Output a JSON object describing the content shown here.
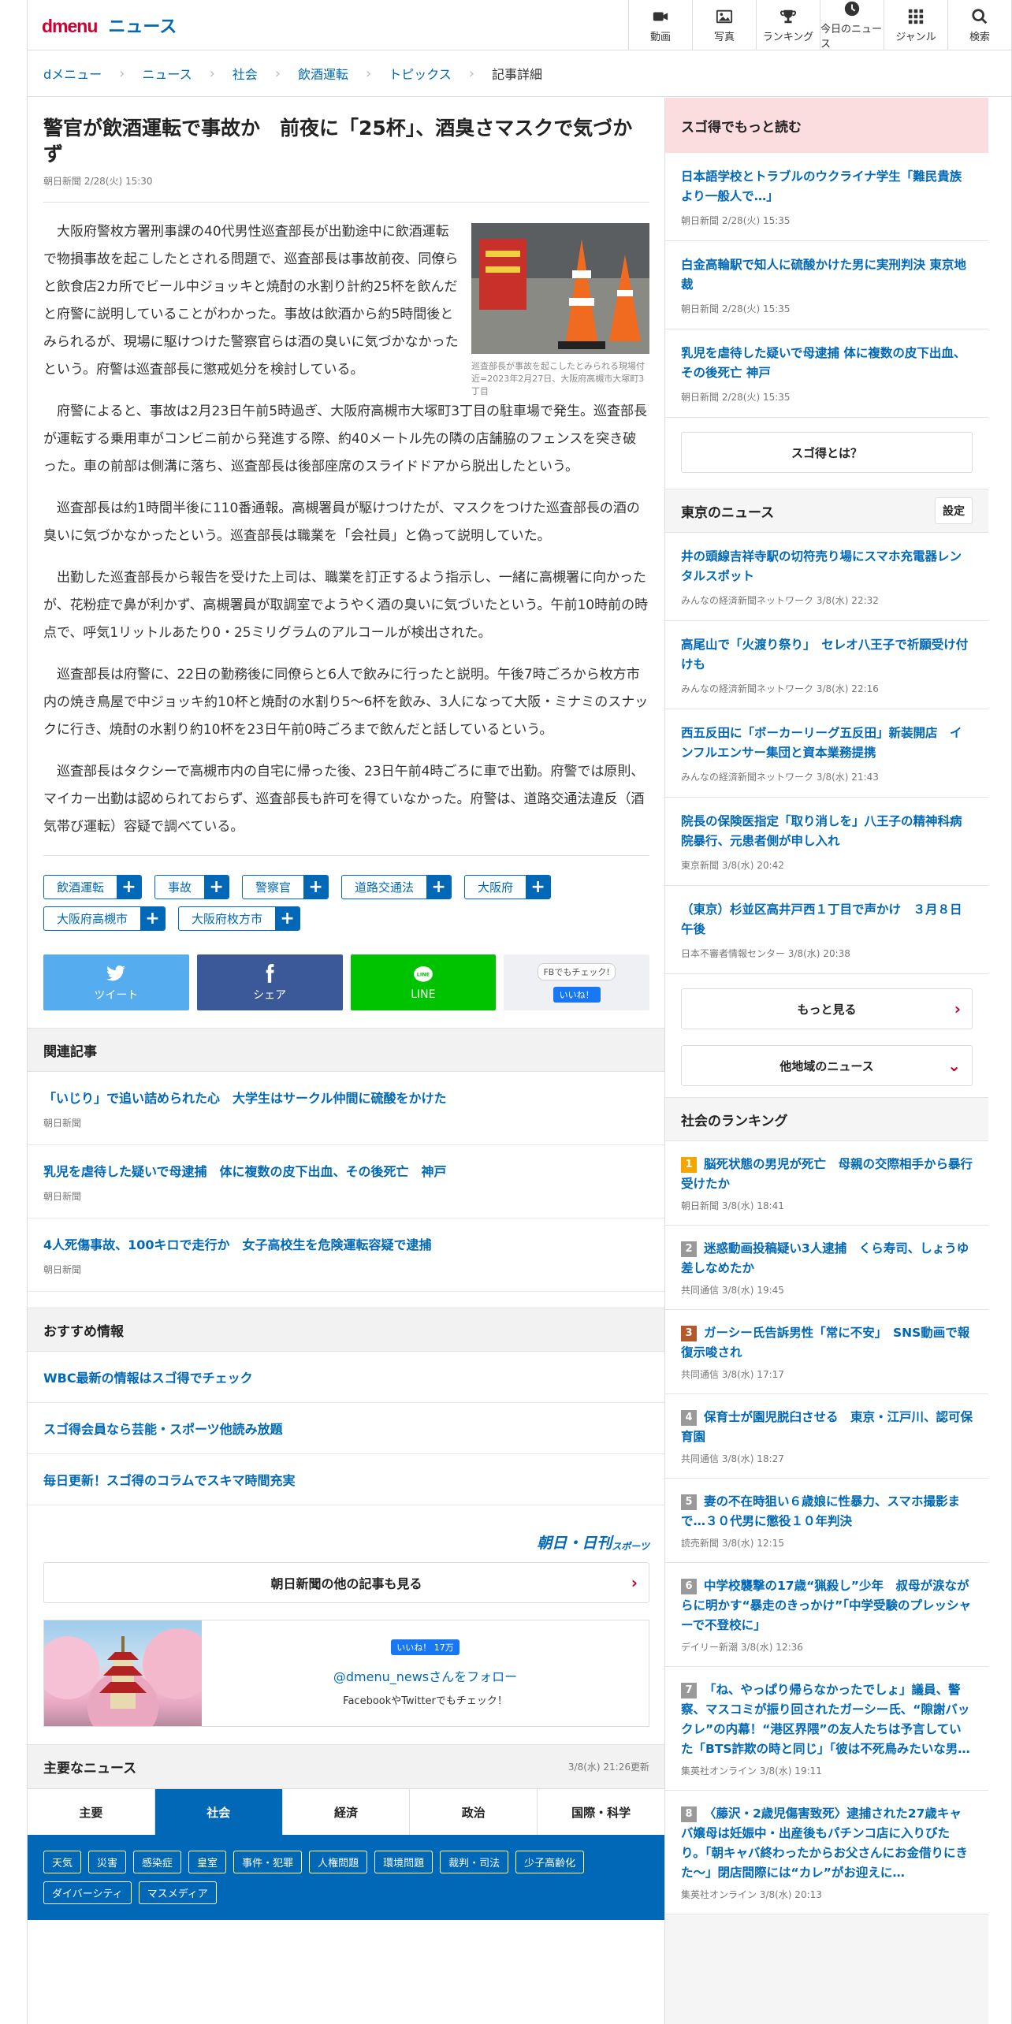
{
  "header": {
    "logo_d": "dmenu",
    "logo_news": "ニュース",
    "nav": [
      {
        "label": "動画",
        "icon": "video-icon"
      },
      {
        "label": "写真",
        "icon": "photo-icon"
      },
      {
        "label": "ランキング",
        "icon": "trophy-icon"
      },
      {
        "label": "今日のニュース",
        "icon": "clock-icon"
      },
      {
        "label": "ジャンル",
        "icon": "grid-icon"
      },
      {
        "label": "検索",
        "icon": "search-icon"
      }
    ]
  },
  "breadcrumb": [
    "dメニュー",
    "ニュース",
    "社会",
    "飲酒運転",
    "トピックス",
    "記事詳細"
  ],
  "article": {
    "title": "警官が飲酒運転で事故か　前夜に「25杯」、酒臭さマスクで気づかず",
    "meta": "朝日新聞 2/28(火) 15:30",
    "image_caption": "巡査部長が事故を起こしたとみられる現場付近=2023年2月27日、大阪府高槻市大塚町3丁目",
    "paragraphs": [
      "大阪府警枚方署刑事課の40代男性巡査部長が出勤途中に飲酒運転で物損事故を起こしたとされる問題で、巡査部長は事故前夜、同僚らと飲食店2カ所でビール中ジョッキと焼酎の水割り計約25杯を飲んだと府警に説明していることがわかった。事故は飲酒から約5時間後とみられるが、現場に駆けつけた警察官らは酒の臭いに気づかなかったという。府警は巡査部長に懲戒処分を検討している。",
      "府警によると、事故は2月23日午前5時過ぎ、大阪府高槻市大塚町3丁目の駐車場で発生。巡査部長が運転する乗用車がコンビニ前から発進する際、約40メートル先の隣の店舗脇のフェンスを突き破った。車の前部は側溝に落ち、巡査部長は後部座席のスライドドアから脱出したという。",
      "巡査部長は約1時間半後に110番通報。高槻署員が駆けつけたが、マスクをつけた巡査部長の酒の臭いに気づかなかったという。巡査部長は職業を「会社員」と偽って説明していた。",
      "出勤した巡査部長から報告を受けた上司は、職業を訂正するよう指示し、一緒に高槻署に向かったが、花粉症で鼻が利かず、高槻署員が取調室でようやく酒の臭いに気づいたという。午前10時前の時点で、呼気1リットルあたり0・25ミリグラムのアルコールが検出された。",
      "巡査部長は府警に、22日の勤務後に同僚らと6人で飲みに行ったと説明。午後7時ごろから枚方市内の焼き鳥屋で中ジョッキ約10杯と焼酎の水割り5〜6杯を飲み、3人になって大阪・ミナミのスナックに行き、焼酎の水割り約10杯を23日午前0時ごろまで飲んだと話しているという。",
      "巡査部長はタクシーで高槻市内の自宅に帰った後、23日午前4時ごろに車で出勤。府警では原則、マイカー出勤は認められておらず、巡査部長も許可を得ていなかった。府警は、道路交通法違反（酒気帯び運転）容疑で調べている。"
    ],
    "tags": [
      "飲酒運転",
      "事故",
      "警察官",
      "道路交通法",
      "大阪府",
      "大阪府高槻市",
      "大阪府枚方市"
    ],
    "share": {
      "tweet": "ツイート",
      "share": "シェア",
      "line": "LINE",
      "fb_check": "FBでもチェック!",
      "like": "いいね！"
    }
  },
  "related": {
    "heading": "関連記事",
    "items": [
      {
        "title": "「いじり」で追い詰められた心　大学生はサークル仲間に硫酸をかけた",
        "source": "朝日新聞"
      },
      {
        "title": "乳児を虐待した疑いで母逮捕　体に複数の皮下出血、その後死亡　神戸",
        "source": "朝日新聞"
      },
      {
        "title": "4人死傷事故、100キロで走行か　女子高校生を危険運転容疑で逮捕",
        "source": "朝日新聞"
      }
    ]
  },
  "recommend": {
    "heading": "おすすめ情報",
    "items": [
      "WBC最新の情報はスゴ得でチェック",
      "スゴ得会員なら芸能・スポーツ他読み放題",
      "毎日更新！スゴ得のコラムでスキマ時間充実"
    ]
  },
  "brand": {
    "main": "朝日・日刊",
    "sub": "スポーツ"
  },
  "more_from": "朝日新聞の他の記事も見る",
  "follow_box": {
    "like": "いいね！ 17万",
    "follow": "@dmenu_newsさんをフォロー",
    "sub": "FacebookやTwitterでもチェック！"
  },
  "main_news": {
    "heading": "主要なニュース",
    "updated": "3/8(水) 21:26更新",
    "tabs": [
      "主要",
      "社会",
      "経済",
      "政治",
      "国際・科学"
    ],
    "active_tab": "社会",
    "categories": [
      "天気",
      "災害",
      "感染症",
      "皇室",
      "事件・犯罪",
      "人権問題",
      "環境問題",
      "裁判・司法",
      "少子高齢化",
      "ダイバーシティ",
      "マスメディア"
    ]
  },
  "side": {
    "sugotoku_heading": "スゴ得でもっと読む",
    "sugotoku": [
      {
        "title": "日本語学校とトラブルのウクライナ学生「難民貴族より一般人で…」",
        "meta": "朝日新聞 2/28(火) 15:35"
      },
      {
        "title": "白金高輪駅で知人に硫酸かけた男に実刑判決 東京地裁",
        "meta": "朝日新聞 2/28(火) 15:35"
      },
      {
        "title": "乳児を虐待した疑いで母逮捕 体に複数の皮下出血、その後死亡 神戸",
        "meta": "朝日新聞 2/28(火) 15:35"
      }
    ],
    "what_sugotoku": "スゴ得とは？",
    "tokyo_heading": "東京のニュース",
    "settings": "設定",
    "tokyo": [
      {
        "title": "井の頭線吉祥寺駅の切符売り場にスマホ充電器レンタルスポット",
        "meta": "みんなの経済新聞ネットワーク 3/8(水) 22:32"
      },
      {
        "title": "高尾山で「火渡り祭り」　セレオ八王子で祈願受け付けも",
        "meta": "みんなの経済新聞ネットワーク 3/8(水) 22:16"
      },
      {
        "title": "西五反田に「ボーカーリーグ五反田」新装開店　インフルエンサー集団と資本業務提携",
        "meta": "みんなの経済新聞ネットワーク 3/8(水) 21:43"
      },
      {
        "title": "院長の保険医指定「取り消しを」八王子の精神科病院暴行、元患者側が申し入れ",
        "meta": "東京新聞 3/8(水) 20:42"
      },
      {
        "title": "（東京）杉並区高井戸西１丁目で声かけ　３月８日午後",
        "meta": "日本不審者情報センター 3/8(水) 20:38"
      }
    ],
    "more": "もっと見る",
    "other_regions": "他地域のニュース",
    "ranking_heading": "社会のランキング",
    "ranking": [
      {
        "rank": "1",
        "title": "脳死状態の男児が死亡　母親の交際相手から暴行受けたか",
        "meta": "朝日新聞 3/8(水) 18:41"
      },
      {
        "rank": "2",
        "title": "迷惑動画投稿疑い3人逮捕　くら寿司、しょうゆ差しなめたか",
        "meta": "共同通信 3/8(水) 19:45"
      },
      {
        "rank": "3",
        "title": "ガーシー氏告訴男性「常に不安」　SNS動画で報復示唆され",
        "meta": "共同通信 3/8(水) 17:17"
      },
      {
        "rank": "4",
        "title": "保育士が園児脱臼させる　東京・江戸川、認可保育園",
        "meta": "共同通信 3/8(水) 18:27"
      },
      {
        "rank": "5",
        "title": "妻の不在時狙い６歳娘に性暴力、スマホ撮影まで…３０代男に懲役１０年判決",
        "meta": "読売新聞 3/8(水) 12:15"
      },
      {
        "rank": "6",
        "title": "中学校襲撃の17歳“猟殺し”少年　叔母が涙ながらに明かす“暴走のきっかけ”「中学受験のプレッシャーで不登校に」",
        "meta": "デイリー新潮 3/8(水) 12:36"
      },
      {
        "rank": "7",
        "title": "「ね、やっぱり帰らなかったでしょ」議員、警察、マスコミが振り回されたガーシー氏、“隙謝バックレ”の内幕！“港区界隈”の友人たちは予言していた「BTS詐欺の時と同じ」「彼は不死鳥みたいな男…",
        "meta": "集英社オンライン 3/8(水) 19:11"
      },
      {
        "rank": "8",
        "title": "〈藤沢・2歳児傷害致死〉逮捕された27歳キャバ嬢母は妊娠中・出産後もパチンコ店に入りびたり。「朝キャバ終わったからお父さんにお金借りにきた〜」閉店間際には“カレ”がお迎えに…",
        "meta": "集英社オンライン 3/8(水) 20:13"
      }
    ]
  },
  "colors": {
    "brand_red": "#cc0033",
    "link_blue": "#0068b7",
    "twitter": "#55acee",
    "facebook": "#3b5998",
    "line": "#00c300",
    "rank1": "#f5a500",
    "rank2": "#999999",
    "rank3": "#b3592b",
    "rank_other": "#9a9a9a"
  }
}
